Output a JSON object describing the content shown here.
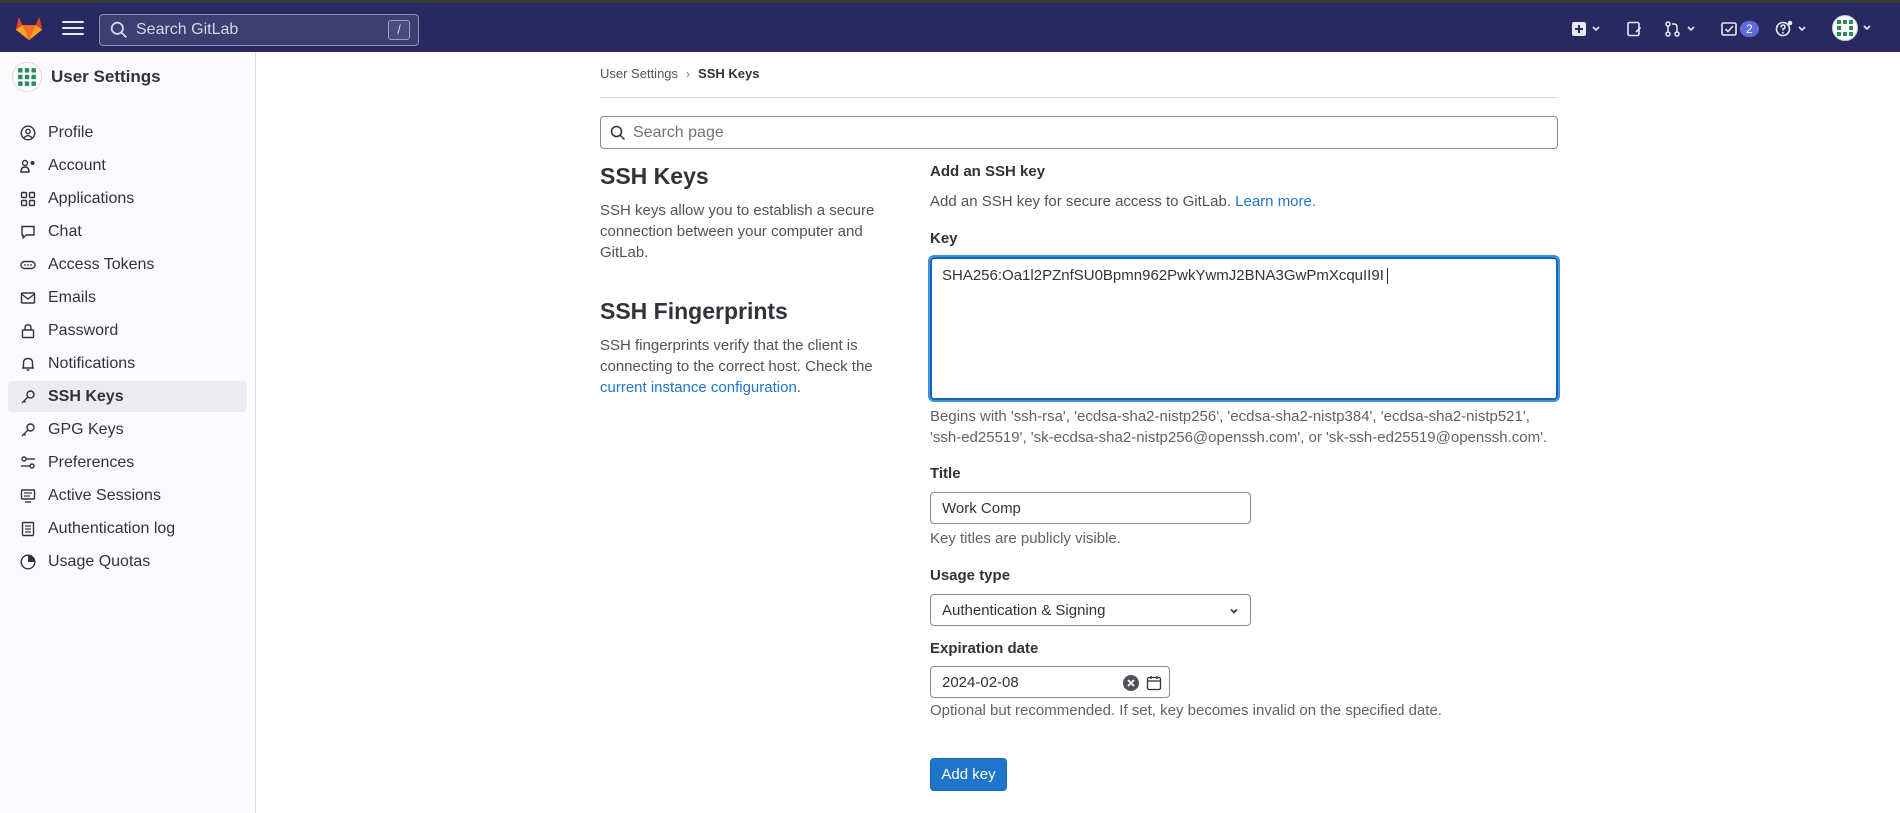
{
  "topbar": {
    "search_placeholder": "Search GitLab",
    "search_shortcut": "/",
    "todo_count": "2"
  },
  "sidebar": {
    "title": "User Settings",
    "items": [
      {
        "label": "Profile",
        "icon": "profile-icon"
      },
      {
        "label": "Account",
        "icon": "account-icon"
      },
      {
        "label": "Applications",
        "icon": "applications-icon"
      },
      {
        "label": "Chat",
        "icon": "chat-icon"
      },
      {
        "label": "Access Tokens",
        "icon": "token-icon"
      },
      {
        "label": "Emails",
        "icon": "mail-icon"
      },
      {
        "label": "Password",
        "icon": "lock-icon"
      },
      {
        "label": "Notifications",
        "icon": "bell-icon"
      },
      {
        "label": "SSH Keys",
        "icon": "key-icon",
        "active": true
      },
      {
        "label": "GPG Keys",
        "icon": "key-icon"
      },
      {
        "label": "Preferences",
        "icon": "preferences-icon"
      },
      {
        "label": "Active Sessions",
        "icon": "monitor-icon"
      },
      {
        "label": "Authentication log",
        "icon": "log-icon"
      },
      {
        "label": "Usage Quotas",
        "icon": "quota-icon"
      }
    ]
  },
  "breadcrumb": {
    "parent": "User Settings",
    "current": "SSH Keys"
  },
  "page_search": {
    "placeholder": "Search page"
  },
  "ssh_keys_section": {
    "title": "SSH Keys",
    "description": "SSH keys allow you to establish a secure connection between your computer and GitLab."
  },
  "fingerprints_section": {
    "title": "SSH Fingerprints",
    "description": "SSH fingerprints verify that the client is connecting to the correct host. Check the",
    "link": "current instance configuration",
    "suffix": "."
  },
  "form": {
    "heading": "Add an SSH key",
    "intro": "Add an SSH key for secure access to GitLab.",
    "intro_link": "Learn more.",
    "key_label": "Key",
    "key_value": "SHA256:Oa1l2PZnfSU0Bpmn962PwkYwmJ2BNA3GwPmXcquII9I",
    "key_help_1": "Begins with 'ssh-rsa', 'ecdsa-sha2-nistp256', 'ecdsa-sha2-nistp384', 'ecdsa-sha2-nistp521',",
    "key_help_2": "'ssh-ed25519', 'sk-ecdsa-sha2-nistp256@openssh.com', or 'sk-ssh-ed25519@openssh.com'.",
    "title_label": "Title",
    "title_value": "Work Comp",
    "title_help": "Key titles are publicly visible.",
    "usage_label": "Usage type",
    "usage_value": "Authentication & Signing",
    "expiration_label": "Expiration date",
    "expiration_value": "2024-02-08",
    "expiration_help": "Optional but recommended. If set, key becomes invalid on the specified date.",
    "submit_label": "Add key"
  },
  "colors": {
    "topbar_bg": "#292961",
    "link": "#1f75cb",
    "primary_button": "#1f75cb"
  }
}
